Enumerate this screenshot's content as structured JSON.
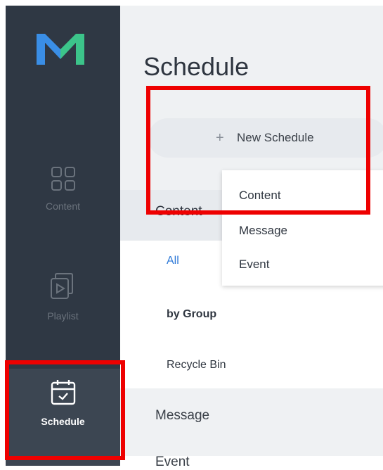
{
  "nav": {
    "items": [
      {
        "label": "Content",
        "icon": "grid-icon"
      },
      {
        "label": "Playlist",
        "icon": "play-layers-icon"
      },
      {
        "label": "Schedule",
        "icon": "calendar-check-icon",
        "active": true
      }
    ]
  },
  "header": {
    "title": "Schedule"
  },
  "toolbar": {
    "new_schedule_label": "New Schedule",
    "plus_glyph": "+"
  },
  "menu": {
    "items": [
      "Content",
      "Message",
      "Event"
    ]
  },
  "sidebar": {
    "content_section_label": "Content",
    "sub_items": [
      "All",
      "by Group",
      "Recycle Bin"
    ],
    "message_section_label": "Message",
    "event_section_label": "Event"
  },
  "colors": {
    "accent": "#2f7ad8",
    "highlight": "#ee0000",
    "rail": "#2f3844",
    "logo_blue": "#3a8ee6",
    "logo_green": "#3cc48a"
  }
}
